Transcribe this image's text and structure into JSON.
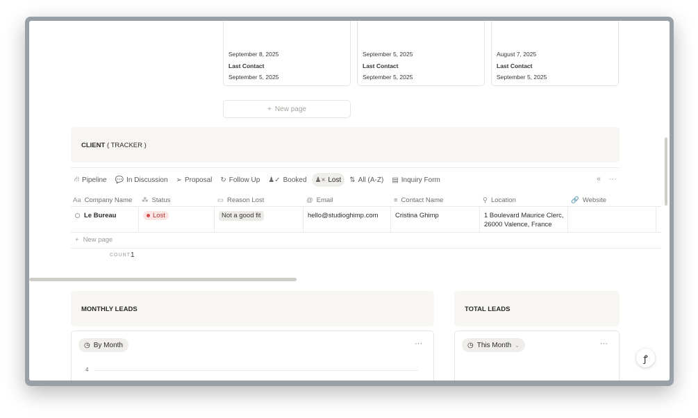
{
  "board_cards": [
    {
      "date1": "September 8, 2025",
      "label": "Last Contact",
      "date2": "September 5, 2025"
    },
    {
      "date1": "September 5, 2025",
      "label": "Last Contact",
      "date2": "September 5, 2025"
    },
    {
      "date1": "August 7, 2025",
      "label": "Last Contact",
      "date2": "September 5, 2025"
    }
  ],
  "new_page_button": "New page",
  "client_tracker": {
    "title_bold": "CLIENT",
    "title_rest": "( TRACKER )"
  },
  "tabs": [
    {
      "label": "Pipeline",
      "icon": "pipeline-icon"
    },
    {
      "label": "In Discussion",
      "icon": "chat-icon"
    },
    {
      "label": "Proposal",
      "icon": "send-icon"
    },
    {
      "label": "Follow Up",
      "icon": "refresh-icon"
    },
    {
      "label": "Booked",
      "icon": "person-check-icon"
    },
    {
      "label": "Lost",
      "icon": "person-x-icon",
      "active": true
    },
    {
      "label": "All (A-Z)",
      "icon": "sort-icon"
    },
    {
      "label": "Inquiry Form",
      "icon": "document-icon"
    }
  ],
  "columns": [
    {
      "label": "Company Name",
      "icon": "title-icon"
    },
    {
      "label": "Status",
      "icon": "status-icon"
    },
    {
      "label": "Reason Lost",
      "icon": "archive-icon"
    },
    {
      "label": "Email",
      "icon": "at-icon"
    },
    {
      "label": "Contact Name",
      "icon": "text-icon"
    },
    {
      "label": "Location",
      "icon": "pin-icon"
    },
    {
      "label": "Website",
      "icon": "link-icon"
    }
  ],
  "row": {
    "company": "Le Bureau",
    "status": "Lost",
    "reason": "Not a good fit",
    "email": "hello@studioghimp.com",
    "contact": "Cristina Ghimp",
    "location_line1": "1 Boulevard Maurice Clerc,",
    "location_line2": "26000 Valence, France",
    "website": ""
  },
  "add_row": "New page",
  "count": {
    "label": "COUNT",
    "value": "1"
  },
  "monthly_leads": {
    "title": "MONTHLY LEADS",
    "view": "By Month",
    "axis_tick": "4"
  },
  "total_leads": {
    "title": "TOTAL LEADS",
    "view": "This Month"
  },
  "colors": {
    "lost_bg": "#fbe4e4",
    "lost_text": "#b7312a",
    "callout_bg": "#f7f6f3"
  }
}
